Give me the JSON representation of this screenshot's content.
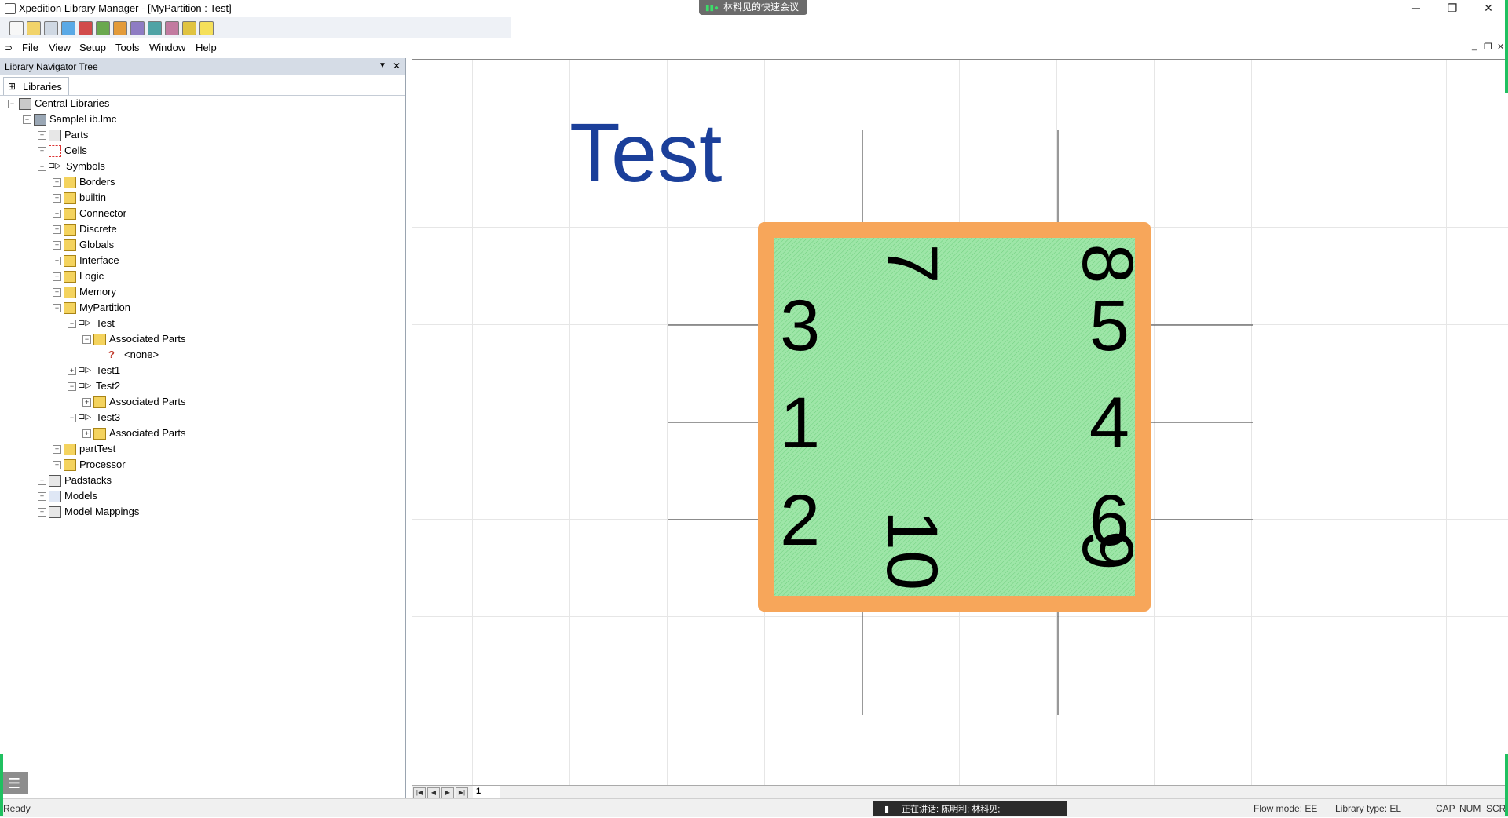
{
  "window": {
    "title": "Xpedition Library Manager - [MyPartition : Test]",
    "minimize": "─",
    "maximize": "❐",
    "close": "✕"
  },
  "meeting_bar": {
    "label": "林料见的快速会议"
  },
  "toolbar": {
    "icons": [
      "new-icon",
      "open-icon",
      "search-icon",
      "verify-icon",
      "part-editor-icon",
      "cell-editor-icon",
      "symbol-editor-icon",
      "padstack-icon",
      "partition-icon",
      "tool-icon",
      "property-icon",
      "help-icon"
    ]
  },
  "menu": {
    "items": [
      "File",
      "View",
      "Setup",
      "Tools",
      "Window",
      "Help"
    ]
  },
  "navigator": {
    "title": "Library Navigator Tree",
    "tab": "Libraries",
    "tree": [
      {
        "label": "Central Libraries",
        "depth": 0,
        "icon": "library",
        "expander": "-"
      },
      {
        "label": "SampleLib.lmc",
        "depth": 1,
        "icon": "lmc",
        "expander": "-"
      },
      {
        "label": "Parts",
        "depth": 2,
        "icon": "parts",
        "expander": "+"
      },
      {
        "label": "Cells",
        "depth": 2,
        "icon": "cells",
        "expander": "+"
      },
      {
        "label": "Symbols",
        "depth": 2,
        "icon": "symbol",
        "expander": "-"
      },
      {
        "label": "Borders",
        "depth": 3,
        "icon": "folder",
        "expander": "+"
      },
      {
        "label": "builtin",
        "depth": 3,
        "icon": "folder",
        "expander": "+"
      },
      {
        "label": "Connector",
        "depth": 3,
        "icon": "folder",
        "expander": "+"
      },
      {
        "label": "Discrete",
        "depth": 3,
        "icon": "folder",
        "expander": "+"
      },
      {
        "label": "Globals",
        "depth": 3,
        "icon": "folder",
        "expander": "+"
      },
      {
        "label": "Interface",
        "depth": 3,
        "icon": "folder",
        "expander": "+"
      },
      {
        "label": "Logic",
        "depth": 3,
        "icon": "folder",
        "expander": "+"
      },
      {
        "label": "Memory",
        "depth": 3,
        "icon": "folder",
        "expander": "+"
      },
      {
        "label": "MyPartition",
        "depth": 3,
        "icon": "folder",
        "expander": "-"
      },
      {
        "label": "Test",
        "depth": 4,
        "icon": "symbol",
        "expander": "-"
      },
      {
        "label": "Associated Parts",
        "depth": 5,
        "icon": "assoc",
        "expander": "-"
      },
      {
        "label": "<none>",
        "depth": 6,
        "icon": "none",
        "expander": ""
      },
      {
        "label": "Test1",
        "depth": 4,
        "icon": "symbol",
        "expander": "+"
      },
      {
        "label": "Test2",
        "depth": 4,
        "icon": "symbol",
        "expander": "-"
      },
      {
        "label": "Associated Parts",
        "depth": 5,
        "icon": "assoc",
        "expander": "+"
      },
      {
        "label": "Test3",
        "depth": 4,
        "icon": "symbol",
        "expander": "-"
      },
      {
        "label": "Associated Parts",
        "depth": 5,
        "icon": "assoc",
        "expander": "+"
      },
      {
        "label": "partTest",
        "depth": 3,
        "icon": "folder",
        "expander": "+"
      },
      {
        "label": "Processor",
        "depth": 3,
        "icon": "folder",
        "expander": "+"
      },
      {
        "label": "Padstacks",
        "depth": 2,
        "icon": "padstack",
        "expander": "+"
      },
      {
        "label": "Models",
        "depth": 2,
        "icon": "models",
        "expander": "+"
      },
      {
        "label": "Model Mappings",
        "depth": 2,
        "icon": "mappings",
        "expander": "+"
      }
    ]
  },
  "symbol": {
    "name": "Test",
    "pins_left": [
      "3",
      "1",
      "2"
    ],
    "pins_right": [
      "5",
      "4",
      "6"
    ],
    "pins_top": [
      "7",
      "8"
    ],
    "pins_bottom": [
      "10",
      "9"
    ],
    "body_fill": "#9ee6a8",
    "border_color": "#f7a65a",
    "name_color": "#1b3f9a"
  },
  "sheet": {
    "tab": "1"
  },
  "status": {
    "left": "Ready",
    "notification": "正在讲话: 陈明利; 林科见;",
    "flow_mode": "Flow mode: EE",
    "library_type": "Library type: EL",
    "cap": "CAP",
    "num": "NUM",
    "scrl": "SCRL"
  }
}
